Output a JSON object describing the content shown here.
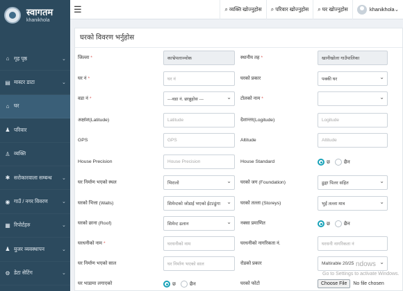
{
  "brand": {
    "title": "स्वागतम",
    "subtitle": "khanikhola"
  },
  "nav": {
    "items": [
      {
        "label": "गृह पृष्ठ",
        "icon": "home-icon",
        "chevron": true
      },
      {
        "label": "मास्टर डाटा",
        "icon": "list-icon",
        "chevron": true
      },
      {
        "label": "घर",
        "icon": "home-icon",
        "chevron": false
      },
      {
        "label": "परिवार",
        "icon": "family-icon",
        "chevron": false
      },
      {
        "label": "व्यक्ति",
        "icon": "person-icon",
        "chevron": false
      },
      {
        "label": "सरोकारवाला सम्बन्ध",
        "icon": "gear-icon",
        "chevron": true
      },
      {
        "label": "गाउँ / नगर विवरण",
        "icon": "location-icon",
        "chevron": true
      },
      {
        "label": "रिपोर्टहरु",
        "icon": "report-icon",
        "chevron": true
      },
      {
        "label": "युजर व्यवस्थापन",
        "icon": "user-icon",
        "chevron": true
      },
      {
        "label": "डेटा सेटिंग",
        "icon": "settings-icon",
        "chevron": true
      }
    ],
    "active_index": 2
  },
  "topbar": {
    "links": [
      {
        "label": "व्यक्ति खोज्नुहोस"
      },
      {
        "label": "परिवार खोज्नुहोस"
      },
      {
        "label": "घर खोज्नुहोस"
      }
    ],
    "user": "khanikhola"
  },
  "form": {
    "title": "घरको विवरण भर्नुहोस",
    "rows": [
      {
        "left": {
          "label": "जिल्ला",
          "required": true,
          "type": "readonly",
          "value": "काभ्रेपलाञ्चोक"
        },
        "right": {
          "label": "स्थानीय तह",
          "required": true,
          "type": "readonly",
          "value": "खानीखोला गाउँपालिका"
        }
      },
      {
        "left": {
          "label": "घर नं",
          "required": true,
          "type": "input",
          "placeholder": "घर नं"
        },
        "right": {
          "label": "घरको प्रकार",
          "required": false,
          "type": "select",
          "value": "पक्की घर"
        }
      },
      {
        "left": {
          "label": "वडा नं",
          "required": true,
          "type": "select",
          "value": "---वडा नं. छान्नुहोस ---"
        },
        "right": {
          "label": "टोलको नाम",
          "required": true,
          "type": "select",
          "value": ""
        }
      },
      {
        "left": {
          "label": "अक्षांश(Latitude)",
          "required": false,
          "type": "input",
          "placeholder": "Latitude"
        },
        "right": {
          "label": "देशान्तर(Logitude)",
          "required": false,
          "type": "input",
          "placeholder": "Logitude"
        }
      },
      {
        "left": {
          "label": "GPS",
          "required": false,
          "type": "input",
          "placeholder": "GPS"
        },
        "right": {
          "label": "Altitude",
          "required": false,
          "type": "input",
          "placeholder": "Altitude"
        }
      },
      {
        "left": {
          "label": "House Precision",
          "required": false,
          "type": "input",
          "placeholder": "House Precision"
        },
        "right": {
          "label": "House Standard",
          "required": false,
          "type": "radio",
          "options": [
            "छ",
            "छैन"
          ],
          "selected": 0
        }
      },
      {
        "left": {
          "label": "घर निर्माण भएको स्थल",
          "required": false,
          "type": "select",
          "value": "भिरालो"
        },
        "right": {
          "label": "घरको जग (Foundation)",
          "required": false,
          "type": "select",
          "value": "ढुङ्गा पिलर सहित"
        }
      },
      {
        "left": {
          "label": "घरको भित्ता (Walls)",
          "required": false,
          "type": "select",
          "value": "सिमेन्टको जोडाई भएको ईटा/ढुंगा"
        },
        "right": {
          "label": "घरको तल्ला (Storeys)",
          "required": false,
          "type": "select",
          "value": "भुईं तल्ला मात्र"
        }
      },
      {
        "left": {
          "label": "घरको छाना (Roof)",
          "required": false,
          "type": "select",
          "value": "सिमेन्ट ढलान"
        },
        "right": {
          "label": "नक्सा प्रमाणित",
          "required": false,
          "type": "radio",
          "options": [
            "छ",
            "छैन"
          ],
          "selected": 0
        }
      },
      {
        "left": {
          "label": "घरधनीको नाम",
          "required": true,
          "type": "input",
          "placeholder": "घरधनीको नाम"
        },
        "right": {
          "label": "घरधनीको नागरिकता नं.",
          "required": false,
          "type": "input",
          "placeholder": "घरधनी नागरिकता नं"
        }
      },
      {
        "left": {
          "label": "घर निर्माण भएको साल",
          "required": false,
          "type": "input",
          "placeholder": "घर निर्माण भएको साल"
        },
        "right": {
          "label": "रोडको प्रकार",
          "required": false,
          "type": "select",
          "value": "Maltirable 20/25"
        }
      },
      {
        "left": {
          "label": "घर भाडामा लगाएको",
          "required": false,
          "type": "radio",
          "options": [
            "छ",
            "छैन"
          ],
          "selected": 0
        },
        "right": {
          "label": "घरको फोटो",
          "required": false,
          "type": "file",
          "button": "Choose File",
          "status": "No file chosen"
        }
      }
    ],
    "watermark": {
      "line1": "ndows",
      "line2": "Go to Settings to activate Windows."
    }
  }
}
